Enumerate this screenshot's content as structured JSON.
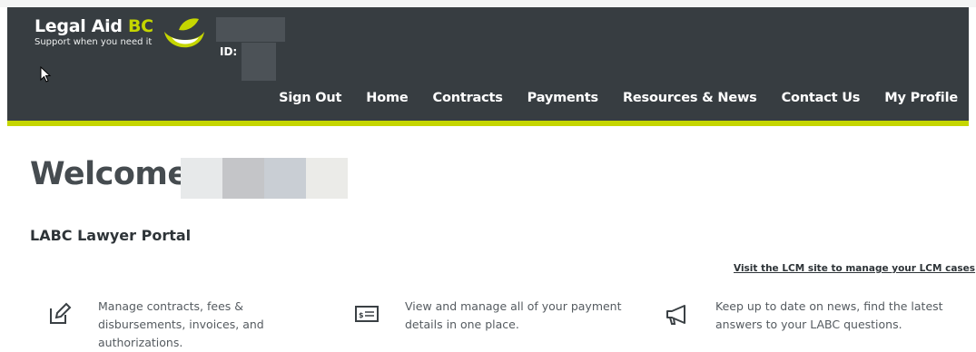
{
  "header": {
    "logo_title_main": "Legal Aid",
    "logo_title_accent": "BC",
    "logo_tagline": "Support when you need it",
    "id_label": "ID:"
  },
  "nav": {
    "items": [
      {
        "label": "Sign Out"
      },
      {
        "label": "Home"
      },
      {
        "label": "Contracts"
      },
      {
        "label": "Payments"
      },
      {
        "label": "Resources & News"
      },
      {
        "label": "Contact Us"
      },
      {
        "label": "My Profile"
      }
    ]
  },
  "main": {
    "welcome": "Welcome",
    "portal_title": "LABC Lawyer Portal",
    "lcm_link": "Visit the LCM site to manage your LCM cases",
    "features": [
      {
        "icon": "edit-icon",
        "text": "Manage contracts, fees & disbursements, invoices, and authorizations."
      },
      {
        "icon": "payment-icon",
        "text": "View and manage all of your payment details in one place."
      },
      {
        "icon": "megaphone-icon",
        "text": "Keep up to date on news, find the latest answers to your LABC questions."
      }
    ]
  },
  "colors": {
    "header_bg": "#373d41",
    "accent": "#c5d600",
    "text_dark": "#333a3f"
  }
}
